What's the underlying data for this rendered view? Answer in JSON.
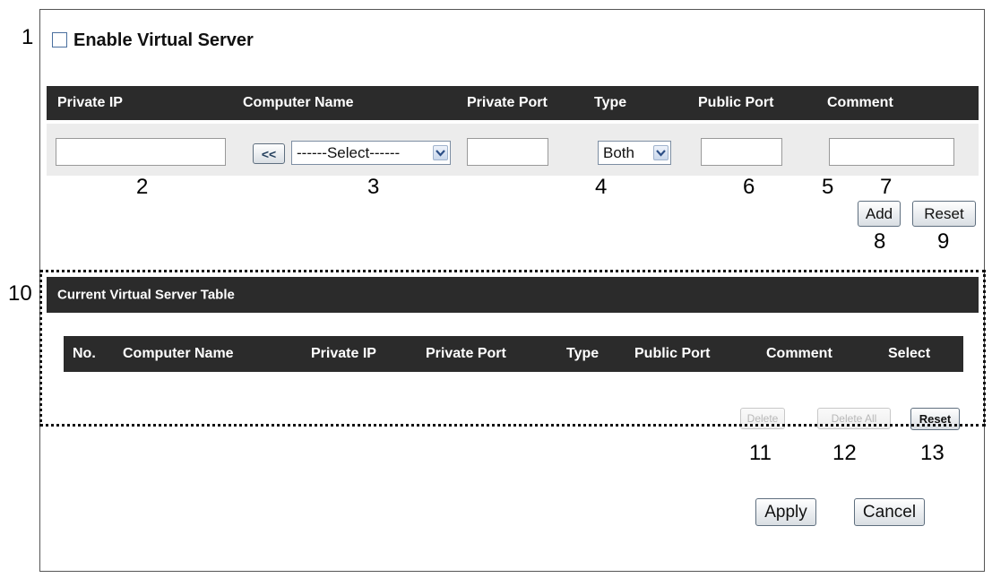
{
  "enable": {
    "label": "Enable Virtual Server",
    "checked": false
  },
  "columns": {
    "private_ip": "Private IP",
    "computer_name": "Computer Name",
    "private_port": "Private Port",
    "type": "Type",
    "public_port": "Public Port",
    "comment": "Comment"
  },
  "form": {
    "copy_button": "<<",
    "computer_select": "------Select------",
    "type_select": "Both",
    "add_button": "Add",
    "reset_button": "Reset"
  },
  "table": {
    "title": "Current Virtual Server Table",
    "columns": [
      "No.",
      "Computer Name",
      "Private IP",
      "Private Port",
      "Type",
      "Public Port",
      "Comment",
      "Select"
    ],
    "delete_button": "Delete",
    "delete_all_button": "Delete All",
    "reset_button": "Reset"
  },
  "footer": {
    "apply_button": "Apply",
    "cancel_button": "Cancel"
  },
  "callouts": [
    "1",
    "2",
    "3",
    "4",
    "5",
    "6",
    "7",
    "8",
    "9",
    "10",
    "11",
    "12",
    "13"
  ],
  "colors": {
    "header_bg": "#2b2b2b",
    "band_bg": "#ececec",
    "accent": "#4a6f9e"
  },
  "icons": [
    "chevron-down-icon"
  ]
}
